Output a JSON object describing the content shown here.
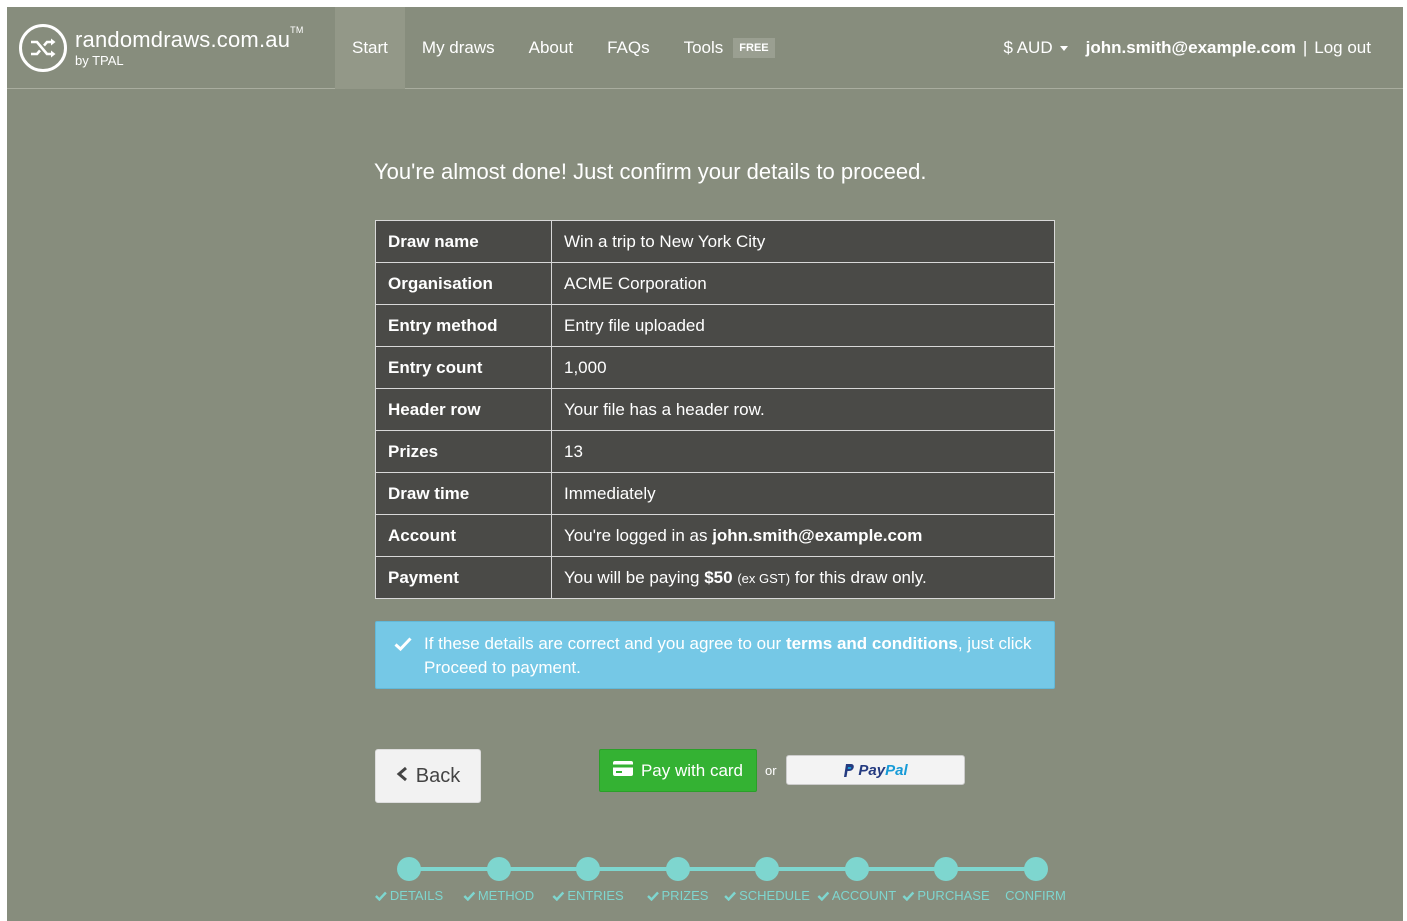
{
  "brand": {
    "name": "randomdraws.com.au",
    "tm": "TM",
    "by": "by TPAL"
  },
  "nav": {
    "items": [
      {
        "label": "Start",
        "active": true
      },
      {
        "label": "My draws"
      },
      {
        "label": "About"
      },
      {
        "label": "FAQs"
      },
      {
        "label": "Tools",
        "badge": "FREE"
      }
    ],
    "currency": "$ AUD",
    "user_email": "john.smith@example.com",
    "separator": "|",
    "logout": "Log out"
  },
  "heading": "You're almost done! Just confirm your details to proceed.",
  "details": {
    "draw_name": {
      "label": "Draw name",
      "value": "Win a trip to New York City"
    },
    "organisation": {
      "label": "Organisation",
      "value": "ACME Corporation"
    },
    "entry_method": {
      "label": "Entry method",
      "value": "Entry file uploaded"
    },
    "entry_count": {
      "label": "Entry count",
      "value": "1,000"
    },
    "header_row": {
      "label": "Header row",
      "value": "Your file has a header row."
    },
    "prizes": {
      "label": "Prizes",
      "value": "13"
    },
    "draw_time": {
      "label": "Draw time",
      "value": "Immediately"
    },
    "account": {
      "label": "Account",
      "prefix": "You're logged in as ",
      "email": "john.smith@example.com"
    },
    "payment": {
      "label": "Payment",
      "prefix": "You will be paying ",
      "amount": "$50",
      "tax": "(ex GST)",
      "suffix": " for this draw only."
    }
  },
  "alert": {
    "before": "If these details are correct and you agree to our ",
    "link": "terms and conditions",
    "after": ", just click Proceed to payment."
  },
  "buttons": {
    "back": "Back",
    "card": "Pay with card",
    "or": "or",
    "paypal_pay": "Pay",
    "paypal_pal": "Pal"
  },
  "progress": {
    "steps": [
      {
        "label": "DETAILS",
        "done": true
      },
      {
        "label": "METHOD",
        "done": true
      },
      {
        "label": "ENTRIES",
        "done": true
      },
      {
        "label": "PRIZES",
        "done": true
      },
      {
        "label": "SCHEDULE",
        "done": true
      },
      {
        "label": "ACCOUNT",
        "done": true
      },
      {
        "label": "PURCHASE",
        "done": true
      },
      {
        "label": "CONFIRM",
        "done": false
      }
    ]
  },
  "colors": {
    "background": "#878d7d",
    "accent": "#7ed6cf",
    "alert": "#75c8e6",
    "card_button": "#34b233",
    "table": "#4a4a47"
  }
}
